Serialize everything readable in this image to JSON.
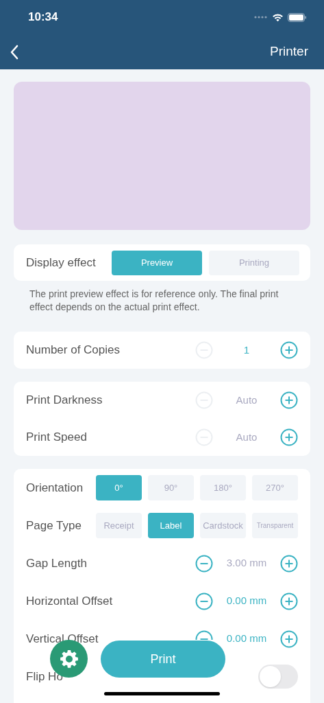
{
  "status_bar": {
    "time": "10:34"
  },
  "nav": {
    "title": "Printer"
  },
  "preview": {
    "kind": "blank"
  },
  "display_effect": {
    "label": "Display effect",
    "options": [
      {
        "label": "Preview",
        "selected": true
      },
      {
        "label": "Printing",
        "selected": false
      }
    ]
  },
  "note": "The print preview effect is for reference only. The final print effect depends on the actual print effect.",
  "copies": [
    {
      "kind": "stepper",
      "label": "Number of Copies",
      "value": "1",
      "decrease_enabled": false,
      "value_highlighted": true
    }
  ],
  "quality": [
    {
      "kind": "stepper",
      "label": "Print Darkness",
      "value": "Auto",
      "decrease_enabled": false,
      "value_highlighted": false
    },
    {
      "kind": "stepper",
      "label": "Print Speed",
      "value": "Auto",
      "decrease_enabled": false,
      "value_highlighted": false
    }
  ],
  "settings": [
    {
      "kind": "segments",
      "label": "Orientation",
      "options": [
        {
          "label": "0°",
          "selected": true
        },
        {
          "label": "90°",
          "selected": false
        },
        {
          "label": "180°",
          "selected": false
        },
        {
          "label": "270°",
          "selected": false
        }
      ]
    },
    {
      "kind": "segments",
      "label": "Page Type",
      "options": [
        {
          "label": "Receipt",
          "selected": false
        },
        {
          "label": "Label",
          "selected": true
        },
        {
          "label": "Cardstock",
          "selected": false
        },
        {
          "label": "Transparent",
          "selected": false
        }
      ]
    },
    {
      "kind": "stepper",
      "label": "Gap Length",
      "value": "3.00 mm",
      "decrease_enabled": true,
      "value_highlighted": false
    },
    {
      "kind": "stepper",
      "label": "Horizontal Offset",
      "value": "0.00 mm",
      "decrease_enabled": true,
      "value_highlighted": true
    },
    {
      "kind": "stepper",
      "label": "Vertical Offset",
      "value": "0.00 mm",
      "decrease_enabled": true,
      "value_highlighted": true
    },
    {
      "kind": "toggle",
      "label": "Flip Ho",
      "on": false
    }
  ],
  "print_button": "Print"
}
